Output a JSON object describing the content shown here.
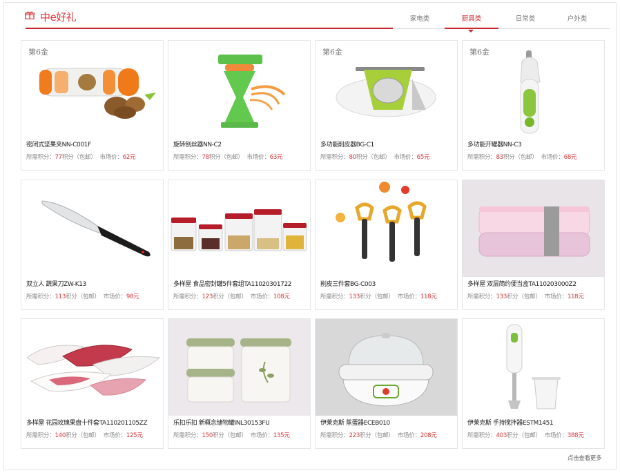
{
  "header": {
    "title": "中e好礼",
    "tabs": [
      {
        "label": "家电类",
        "active": false
      },
      {
        "label": "厨具类",
        "active": true
      },
      {
        "label": "日常类",
        "active": false
      },
      {
        "label": "户外类",
        "active": false
      }
    ]
  },
  "labels": {
    "points_prefix": "所需积分：",
    "points_suffix": "积分（包邮）",
    "market_prefix": "市场价：",
    "market_suffix": "元",
    "brand_watermark": "第6金"
  },
  "products": [
    {
      "name": "密闭式坚果夹NN-C001F",
      "points": "77",
      "price": "62"
    },
    {
      "name": "旋转刨丝器NN-C2",
      "points": "78",
      "price": "63"
    },
    {
      "name": "多功能削皮器BG-C1",
      "points": "80",
      "price": "65"
    },
    {
      "name": "多功能开罐器NN-C3",
      "points": "83",
      "price": "68"
    },
    {
      "name": "双立人 蔬果刀ZW-K13",
      "points": "113",
      "price": "98"
    },
    {
      "name": "多样屋 食品密封罐5件套组TA11020301722",
      "points": "123",
      "price": "108"
    },
    {
      "name": "削皮三件套BG-C003",
      "points": "133",
      "price": "118"
    },
    {
      "name": "多样屋 双层简约便当盒TA110203000Z2",
      "points": "133",
      "price": "118"
    },
    {
      "name": "多样屋 花园玫瑰果盘十件套TA110201105ZZ",
      "points": "140",
      "price": "125"
    },
    {
      "name": "乐扣乐扣 新概念储物罐INL30153FU",
      "points": "150",
      "price": "135"
    },
    {
      "name": "伊莱克斯 蒸蛋器ECEB010",
      "points": "223",
      "price": "208"
    },
    {
      "name": "伊莱克斯 手持搅拌器ESTM1451",
      "points": "403",
      "price": "388"
    }
  ],
  "footer": {
    "more": "点击查看更多"
  },
  "colors": {
    "accent": "#c8282d",
    "price_red": "#d8383c",
    "text_gray": "#888888",
    "border": "#e6e6e6"
  }
}
